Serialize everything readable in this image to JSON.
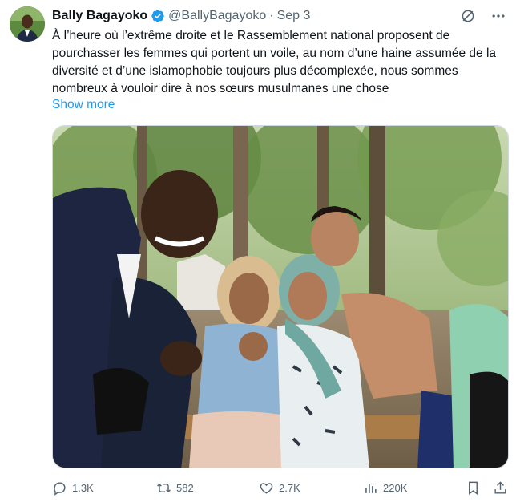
{
  "tweet": {
    "author_name": "Bally Bagayoko",
    "handle": "@BallyBagayoko",
    "separator": "·",
    "date": "Sep 3",
    "text": "À l’heure où l’extrême droite et le Rassemblement national proposent de pourchasser les femmes qui portent un voile, au nom d’une haine assumée de la diversité et d’une islamophobie toujours plus décomplexée, nous sommes nombreux à vouloir dire à nos sœurs musulmanes une chose",
    "show_more": "Show more"
  },
  "icons": {
    "verified": "verified-badge-icon",
    "grok": "grok-icon",
    "more": "more-icon",
    "reply": "reply-icon",
    "retweet": "retweet-icon",
    "like": "like-icon",
    "views": "views-icon",
    "bookmark": "bookmark-icon",
    "share": "share-icon"
  },
  "actions": {
    "replies": "1.3K",
    "retweets": "582",
    "likes": "2.7K",
    "views": "220K"
  },
  "colors": {
    "link": "#1d9bf0",
    "secondary_text": "#536471",
    "primary_text": "#0f1419"
  }
}
